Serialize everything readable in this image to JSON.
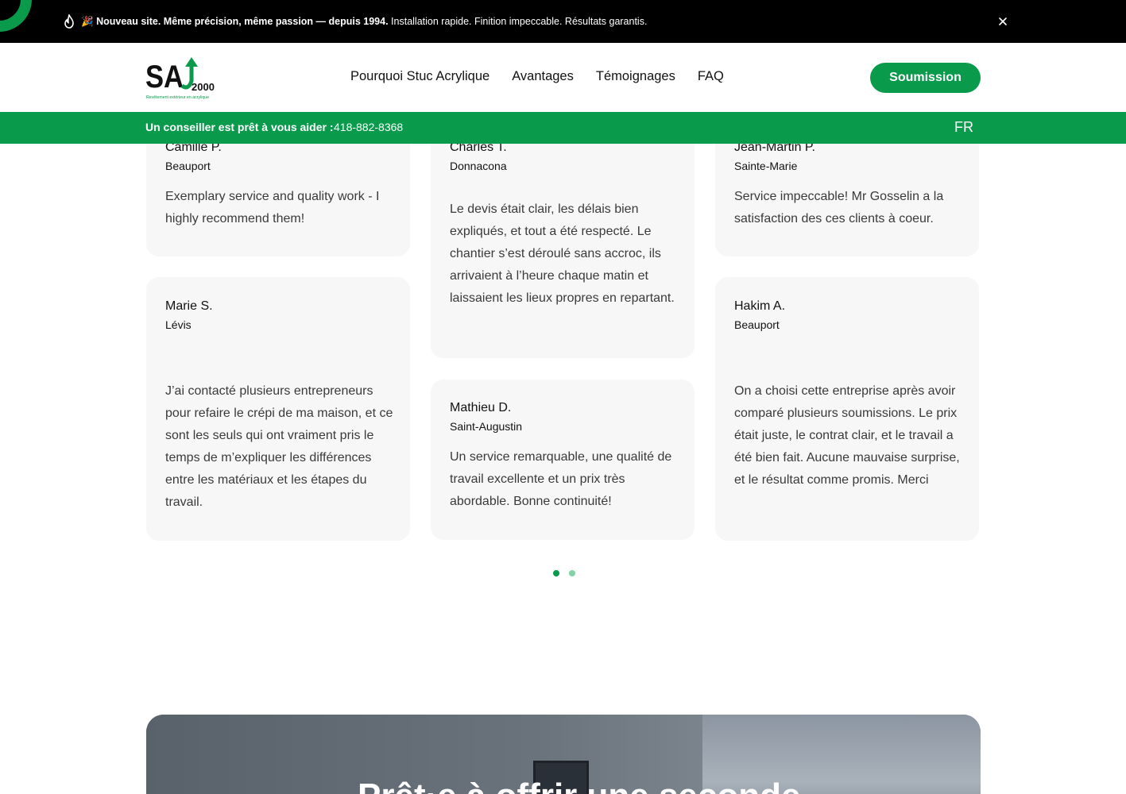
{
  "announcement": {
    "emoji": "🎉",
    "bold": "Nouveau site. Même précision, même passion — depuis 1994.",
    "rest": "Installation rapide. Finition impeccable. Résultats garantis."
  },
  "header": {
    "logo_text": "SA",
    "logo_year": "2000",
    "logo_tagline": "Revêtement extérieur en acrylique",
    "nav": [
      "Pourquoi Stuc Acrylique",
      "Avantages",
      "Témoignages",
      "FAQ"
    ],
    "cta": "Soumission"
  },
  "helpbar": {
    "help": "Un conseiller est prêt à vous aider :",
    "phone": "418-882-8368",
    "lang": "FR"
  },
  "testimonials": [
    {
      "name": "Camille P.",
      "city": "Beauport",
      "text": "Exemplary service and quality work - I highly recommend them!"
    },
    {
      "name": "Charles T.",
      "city": "Donnacona",
      "text": "Le devis était clair, les délais bien expliqués, et tout a été respecté. Le chantier s’est déroulé sans accroc, ils arrivaient à l’heure chaque matin et laissaient les lieux propres en repartant."
    },
    {
      "name": "Jean-Martin P.",
      "city": "Sainte-Marie",
      "text": "Service impeccable! Mr Gosselin a la satisfaction des ces clients à coeur."
    },
    {
      "name": "Marie S.",
      "city": "Lévis",
      "text": "J’ai contacté plusieurs entrepreneurs pour refaire le crépi de ma maison, et ce sont les seuls qui ont vraiment pris le temps de m’expliquer les différences entre les matériaux et les étapes du travail."
    },
    {
      "name": "Mathieu D.",
      "city": "Saint-Augustin",
      "text": "Un service remarquable, une qualité de travail excellente et un prix très abordable. Bonne continuité!"
    },
    {
      "name": "Hakim A.",
      "city": "Beauport",
      "text": "On a choisi cette entreprise après avoir comparé plusieurs soumissions. Le prix était juste, le contrat clair, et le travail a été bien fait. Aucune mauvaise surprise, et le résultat comme promis. Merci"
    }
  ],
  "hero": {
    "headline": "Prêt·e à offrir une seconde"
  },
  "colors": {
    "brand_green": "#0a9a4b",
    "announcement_bg": "#000000",
    "card_bg": "#f7f7f7"
  }
}
